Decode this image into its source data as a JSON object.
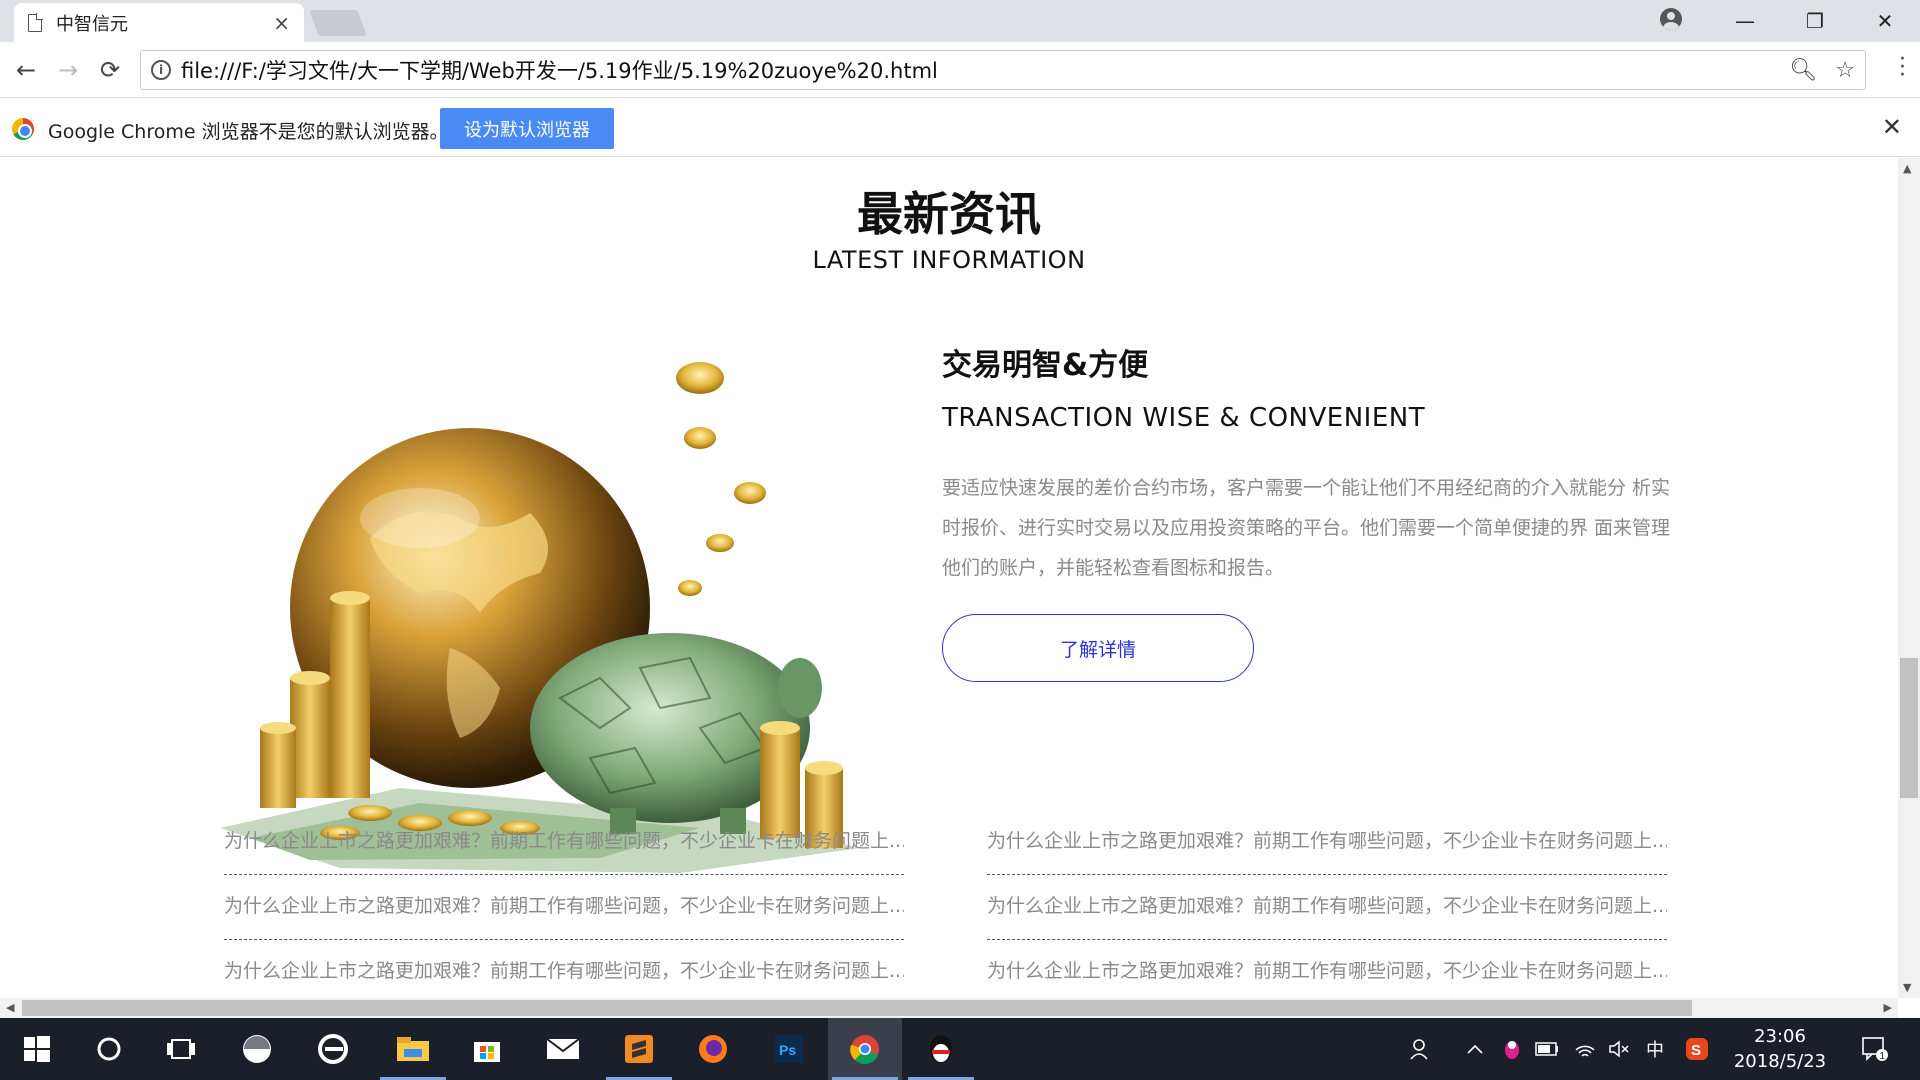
{
  "browser": {
    "tab_title": "中智信元",
    "tab_close": "×",
    "url": "file:///F:/学习文件/大一下学期/Web开发一/5.19作业/5.19%20zuoye%20.html",
    "infobar_text": "Google Chrome 浏览器不是您的默认浏览器。",
    "infobar_button": "设为默认浏览器",
    "infobar_close": "✕",
    "icons": {
      "back": "←",
      "forward": "→",
      "reload": "⟳",
      "zoom": "🔍︎",
      "star": "☆",
      "info": "i",
      "minimize": "—",
      "restore": "❐",
      "close": "✕"
    }
  },
  "page": {
    "section_title": "最新资讯",
    "section_subtitle": "LATEST INFORMATION",
    "feature": {
      "heading": "交易明智&方便",
      "subheading": "TRANSACTION WISE & CONVENIENT",
      "description": "要适应快速发展的差价合约市场，客户需要一个能让他们不用经纪商的介入就能分 析实时报价、进行实时交易以及应用投资策略的平台。他们需要一个简单便捷的界 面来管理他们的账户，并能轻松查看图标和报告。",
      "button": "了解详情"
    },
    "news_left": [
      "为什么企业上市之路更加艰难？前期工作有哪些问题，不少企业卡在财务问题上...",
      "为什么企业上市之路更加艰难？前期工作有哪些问题，不少企业卡在财务问题上...",
      "为什么企业上市之路更加艰难？前期工作有哪些问题，不少企业卡在财务问题上..."
    ],
    "news_right": [
      "为什么企业上市之路更加艰难？前期工作有哪些问题，不少企业卡在财务问题上...",
      "为什么企业上市之路更加艰难？前期工作有哪些问题，不少企业卡在财务问题上...",
      "为什么企业上市之路更加艰难？前期工作有哪些问题，不少企业卡在财务问题上..."
    ]
  },
  "taskbar": {
    "clock_time": "23:06",
    "clock_date": "2018/5/23",
    "ime": "中",
    "notification_count": "1",
    "apps": [
      "start-icon",
      "cortana-icon",
      "task-view-icon",
      "pinwheel-app-icon",
      "edge-icon",
      "file-explorer-icon",
      "store-icon",
      "mail-icon",
      "sublime-icon",
      "firefox-icon",
      "photoshop-icon",
      "chrome-icon",
      "qq-icon"
    ]
  },
  "colors": {
    "accent_blue": "#2c33d0",
    "button_blue": "#4a8af4",
    "body_gray": "#8a8a8a",
    "taskbar": "#1b1f2a"
  }
}
